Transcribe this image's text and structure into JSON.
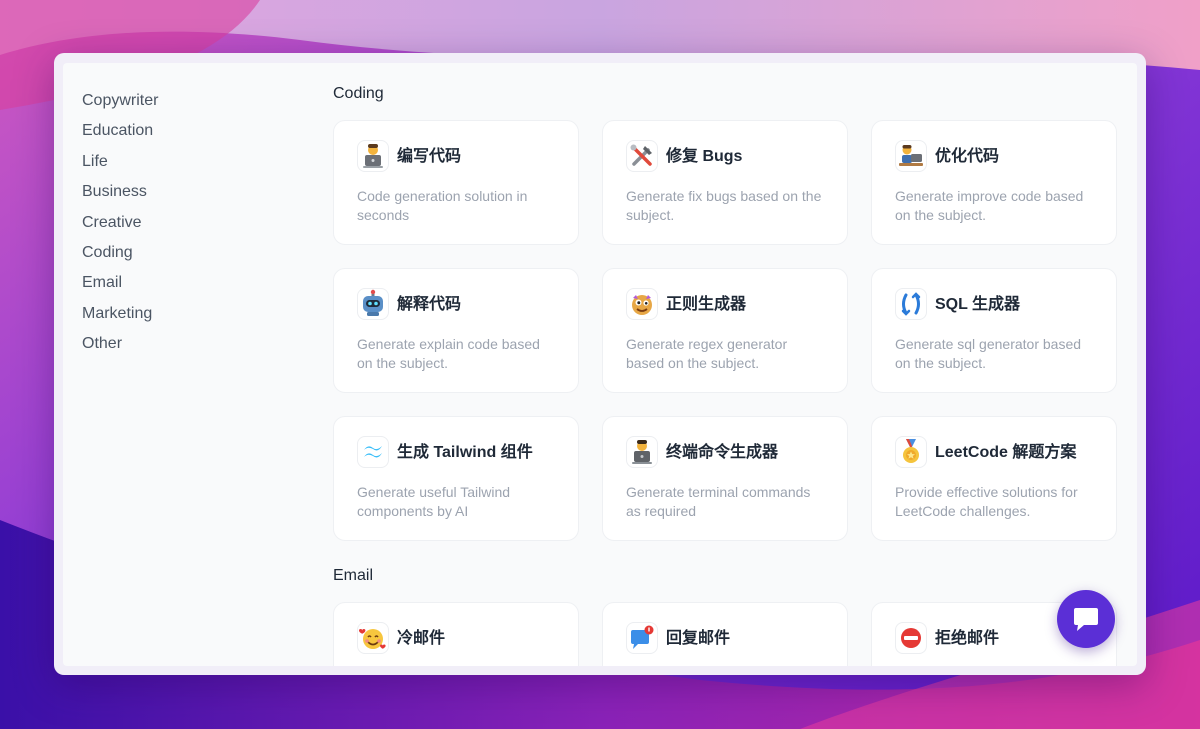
{
  "sidebar": {
    "items": [
      {
        "label": "Copywriter"
      },
      {
        "label": "Education"
      },
      {
        "label": "Life"
      },
      {
        "label": "Business"
      },
      {
        "label": "Creative"
      },
      {
        "label": "Coding"
      },
      {
        "label": "Email"
      },
      {
        "label": "Marketing"
      },
      {
        "label": "Other"
      }
    ]
  },
  "sections": [
    {
      "title": "Coding",
      "cards": [
        {
          "icon": "laptop-person-icon",
          "title": "编写代码",
          "desc": "Code generation solution in seconds"
        },
        {
          "icon": "tools-icon",
          "title": "修复 Bugs",
          "desc": "Generate fix bugs based on the subject."
        },
        {
          "icon": "desk-person-icon",
          "title": "优化代码",
          "desc": "Generate improve code based on the subject."
        },
        {
          "icon": "robot-icon",
          "title": "解释代码",
          "desc": "Generate explain code based on the subject."
        },
        {
          "icon": "monster-icon",
          "title": "正则生成器",
          "desc": "Generate regex generator based on the subject."
        },
        {
          "icon": "sync-arrows-icon",
          "title": "SQL 生成器",
          "desc": "Generate sql generator based on the subject."
        },
        {
          "icon": "tailwind-icon",
          "title": "生成 Tailwind 组件",
          "desc": "Generate useful Tailwind components by AI"
        },
        {
          "icon": "terminal-person-icon",
          "title": "终端命令生成器",
          "desc": "Generate terminal commands as required"
        },
        {
          "icon": "medal-icon",
          "title": "LeetCode 解题方案",
          "desc": "Provide effective solutions for LeetCode challenges."
        }
      ]
    },
    {
      "title": "Email",
      "cards": [
        {
          "icon": "hearts-face-icon",
          "title": "冷邮件",
          "desc": ""
        },
        {
          "icon": "message-notification-icon",
          "title": "回复邮件",
          "desc": ""
        },
        {
          "icon": "no-entry-icon",
          "title": "拒绝邮件",
          "desc": ""
        }
      ]
    }
  ],
  "chat": {
    "icon": "chat-bubble-icon"
  },
  "colors": {
    "accent": "#5b2fd6",
    "title_text": "#1f2937",
    "desc_text": "#9ca3af",
    "sidebar_text": "#4b5563"
  }
}
